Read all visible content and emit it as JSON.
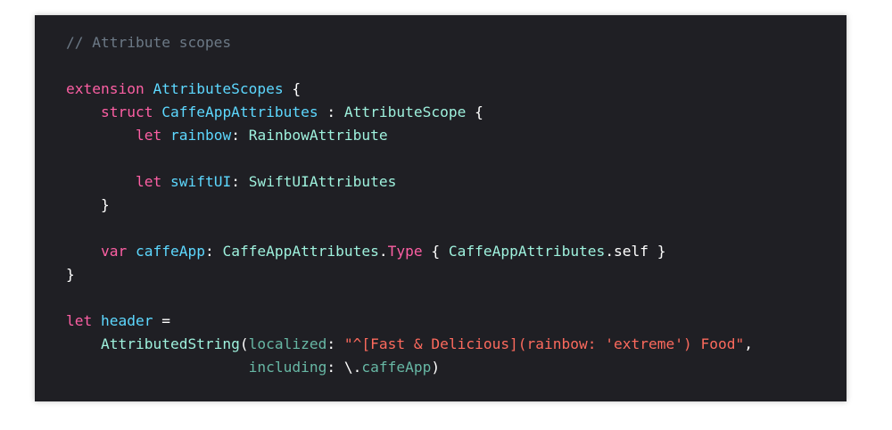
{
  "colors": {
    "background": "#1f1f24",
    "plain": "#ffffff",
    "comment": "#6c7986",
    "keyword": "#fc5fa3",
    "type_decl": "#5dd8ff",
    "type_ref": "#9ef1dd",
    "identifier": "#67b7a4",
    "string": "#fc6a5d"
  },
  "code_lines": [
    [
      {
        "t": "// Attribute scopes",
        "c": "comment"
      }
    ],
    [],
    [
      {
        "t": "extension",
        "c": "keyword"
      },
      {
        "t": " ",
        "c": "plain"
      },
      {
        "t": "AttributeScopes",
        "c": "type_decl"
      },
      {
        "t": " {",
        "c": "plain"
      }
    ],
    [
      {
        "t": "    ",
        "c": "plain"
      },
      {
        "t": "struct",
        "c": "keyword"
      },
      {
        "t": " ",
        "c": "plain"
      },
      {
        "t": "CaffeAppAttributes",
        "c": "type_decl"
      },
      {
        "t": " : ",
        "c": "plain"
      },
      {
        "t": "AttributeScope",
        "c": "type_ref"
      },
      {
        "t": " {",
        "c": "plain"
      }
    ],
    [
      {
        "t": "        ",
        "c": "plain"
      },
      {
        "t": "let",
        "c": "keyword"
      },
      {
        "t": " ",
        "c": "plain"
      },
      {
        "t": "rainbow",
        "c": "type_decl"
      },
      {
        "t": ": ",
        "c": "plain"
      },
      {
        "t": "RainbowAttribute",
        "c": "type_ref"
      }
    ],
    [],
    [
      {
        "t": "        ",
        "c": "plain"
      },
      {
        "t": "let",
        "c": "keyword"
      },
      {
        "t": " ",
        "c": "plain"
      },
      {
        "t": "swiftUI",
        "c": "type_decl"
      },
      {
        "t": ": ",
        "c": "plain"
      },
      {
        "t": "SwiftUIAttributes",
        "c": "type_ref"
      }
    ],
    [
      {
        "t": "    }",
        "c": "plain"
      }
    ],
    [],
    [
      {
        "t": "    ",
        "c": "plain"
      },
      {
        "t": "var",
        "c": "keyword"
      },
      {
        "t": " ",
        "c": "plain"
      },
      {
        "t": "caffeApp",
        "c": "type_decl"
      },
      {
        "t": ": ",
        "c": "plain"
      },
      {
        "t": "CaffeAppAttributes",
        "c": "type_ref"
      },
      {
        "t": ".",
        "c": "plain"
      },
      {
        "t": "Type",
        "c": "keyword"
      },
      {
        "t": " { ",
        "c": "plain"
      },
      {
        "t": "CaffeAppAttributes",
        "c": "type_ref"
      },
      {
        "t": ".self }",
        "c": "plain"
      }
    ],
    [
      {
        "t": "}",
        "c": "plain"
      }
    ],
    [],
    [
      {
        "t": "let",
        "c": "keyword"
      },
      {
        "t": " ",
        "c": "plain"
      },
      {
        "t": "header",
        "c": "type_decl"
      },
      {
        "t": " =",
        "c": "plain"
      }
    ],
    [
      {
        "t": "    ",
        "c": "plain"
      },
      {
        "t": "AttributedString",
        "c": "type_ref"
      },
      {
        "t": "(",
        "c": "plain"
      },
      {
        "t": "localized",
        "c": "identifier"
      },
      {
        "t": ": ",
        "c": "plain"
      },
      {
        "t": "\"^[Fast & Delicious](rainbow: 'extreme') Food\"",
        "c": "string"
      },
      {
        "t": ",",
        "c": "plain"
      }
    ],
    [
      {
        "t": "                     ",
        "c": "plain"
      },
      {
        "t": "including",
        "c": "identifier"
      },
      {
        "t": ": \\.",
        "c": "plain"
      },
      {
        "t": "caffeApp",
        "c": "identifier"
      },
      {
        "t": ")",
        "c": "plain"
      }
    ]
  ]
}
